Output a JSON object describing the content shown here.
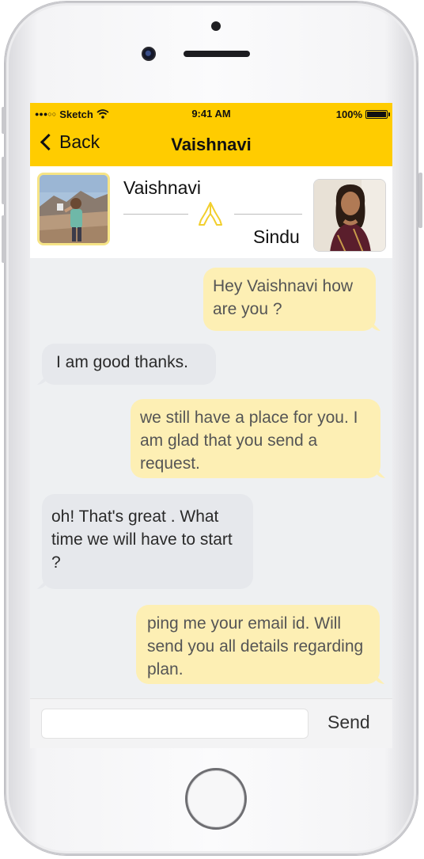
{
  "status_bar": {
    "carrier": "Sketch",
    "time": "9:41 AM",
    "battery": "100%"
  },
  "nav": {
    "back_label": "Back",
    "title": "Vaishnavi"
  },
  "match": {
    "left_name": "Vaishnavi",
    "right_name": "Sindu"
  },
  "messages": [
    {
      "side": "out",
      "text": "Hey Vaishnavi how are you ?"
    },
    {
      "side": "in",
      "text": "I am good thanks."
    },
    {
      "side": "out",
      "text": "we still have a place for you. I am glad that you send a request."
    },
    {
      "side": "in",
      "text": "oh! That's great . What time we will have to start ?"
    },
    {
      "side": "out",
      "text": "ping me your email id. Will send you all details regarding plan."
    }
  ],
  "composer": {
    "placeholder": "",
    "send_label": "Send"
  },
  "colors": {
    "accent": "#ffcc00",
    "outgoing_bubble": "#fdefb4",
    "incoming_bubble": "#e6e8ec"
  }
}
